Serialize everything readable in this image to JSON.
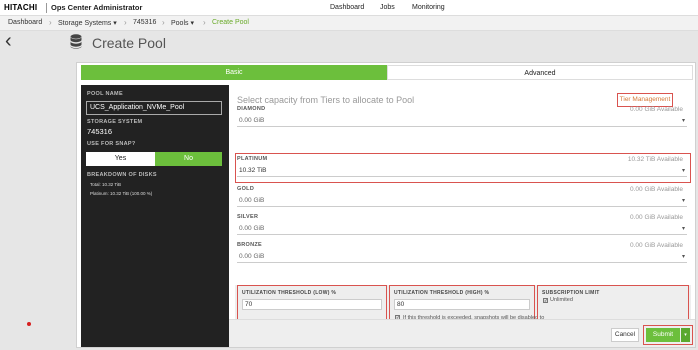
{
  "header": {
    "brand": "HITACHI",
    "app_name": "Ops Center Administrator",
    "nav": [
      "Dashboard",
      "Jobs",
      "Monitoring"
    ]
  },
  "breadcrumb": [
    "Dashboard",
    "Storage Systems ▾",
    "745316",
    "Pools ▾",
    "Create Pool"
  ],
  "page_title": "Create Pool",
  "tabs": {
    "basic": "Basic",
    "advanced": "Advanced"
  },
  "sidebar": {
    "pool_name_label": "POOL NAME",
    "pool_name_value": "UCS_Application_NVMe_Pool",
    "storage_system_label": "STORAGE SYSTEM",
    "storage_system_value": "745316",
    "use_for_snap_label": "USE FOR SNAP?",
    "yes": "Yes",
    "no": "No",
    "breakdown_label": "BREAKDOWN OF DISKS",
    "total": "Total: 10.32 TiB",
    "platinum": "Platinum: 10.32 TiB (100.00 %)"
  },
  "content": {
    "headline": "Select capacity from Tiers to allocate to Pool",
    "tier_management": "Tier Management",
    "tiers": [
      {
        "name": "DIAMOND",
        "available": "0.00 GiB Available",
        "value": "0.00 GiB"
      },
      {
        "name": "PLATINUM",
        "available": "10.32 TiB Available",
        "value": "10.32 TiB"
      },
      {
        "name": "GOLD",
        "available": "0.00 GiB Available",
        "value": "0.00 GiB"
      },
      {
        "name": "SILVER",
        "available": "0.00 GiB Available",
        "value": "0.00 GiB"
      },
      {
        "name": "BRONZE",
        "available": "0.00 GiB Available",
        "value": "0.00 GiB"
      }
    ],
    "threshold_low_label": "UTILIZATION THRESHOLD (LOW) %",
    "threshold_low_value": "70",
    "threshold_high_label": "UTILIZATION THRESHOLD (HIGH) %",
    "threshold_high_value": "80",
    "threshold_note": "If this threshold is exceeded, snapshots will be disabled to ensure there is enough capacity for user data.",
    "subscription_label": "SUBSCRIPTION LIMIT",
    "unlimited": "Unlimited"
  },
  "footer": {
    "cancel": "Cancel",
    "submit": "Submit"
  },
  "colors": {
    "accent": "#6cbf3c",
    "highlight": "#d9534f",
    "link": "#d47a3a"
  }
}
